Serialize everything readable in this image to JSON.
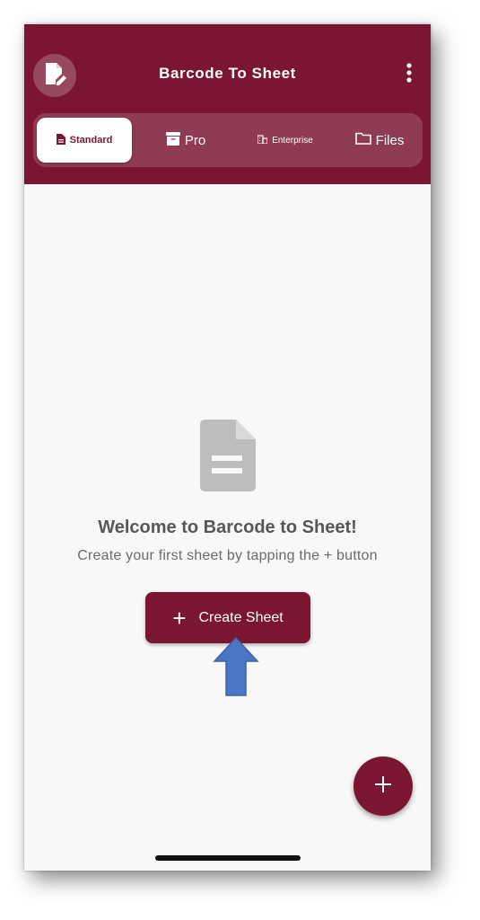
{
  "app": {
    "title": "Barcode To Sheet",
    "brand_color": "#7a1631"
  },
  "header": {
    "logo_icon": "sheet-edit-icon",
    "menu_icon": "more-vertical-icon"
  },
  "tabs": [
    {
      "label": "Standard",
      "icon": "document-icon",
      "active": true
    },
    {
      "label": "Pro",
      "icon": "archive-icon",
      "active": false
    },
    {
      "label": "Enterprise",
      "icon": "building-icon",
      "active": false
    },
    {
      "label": "Files",
      "icon": "folder-icon",
      "active": false
    }
  ],
  "empty_state": {
    "icon": "document-icon",
    "title": "Welcome to Barcode to Sheet!",
    "subtitle": "Create your first sheet by tapping the + button",
    "button_label": "Create Sheet",
    "button_icon": "+"
  },
  "fab": {
    "icon": "+"
  },
  "annotation": {
    "icon": "up-arrow-icon",
    "color": "#4a76c4"
  }
}
